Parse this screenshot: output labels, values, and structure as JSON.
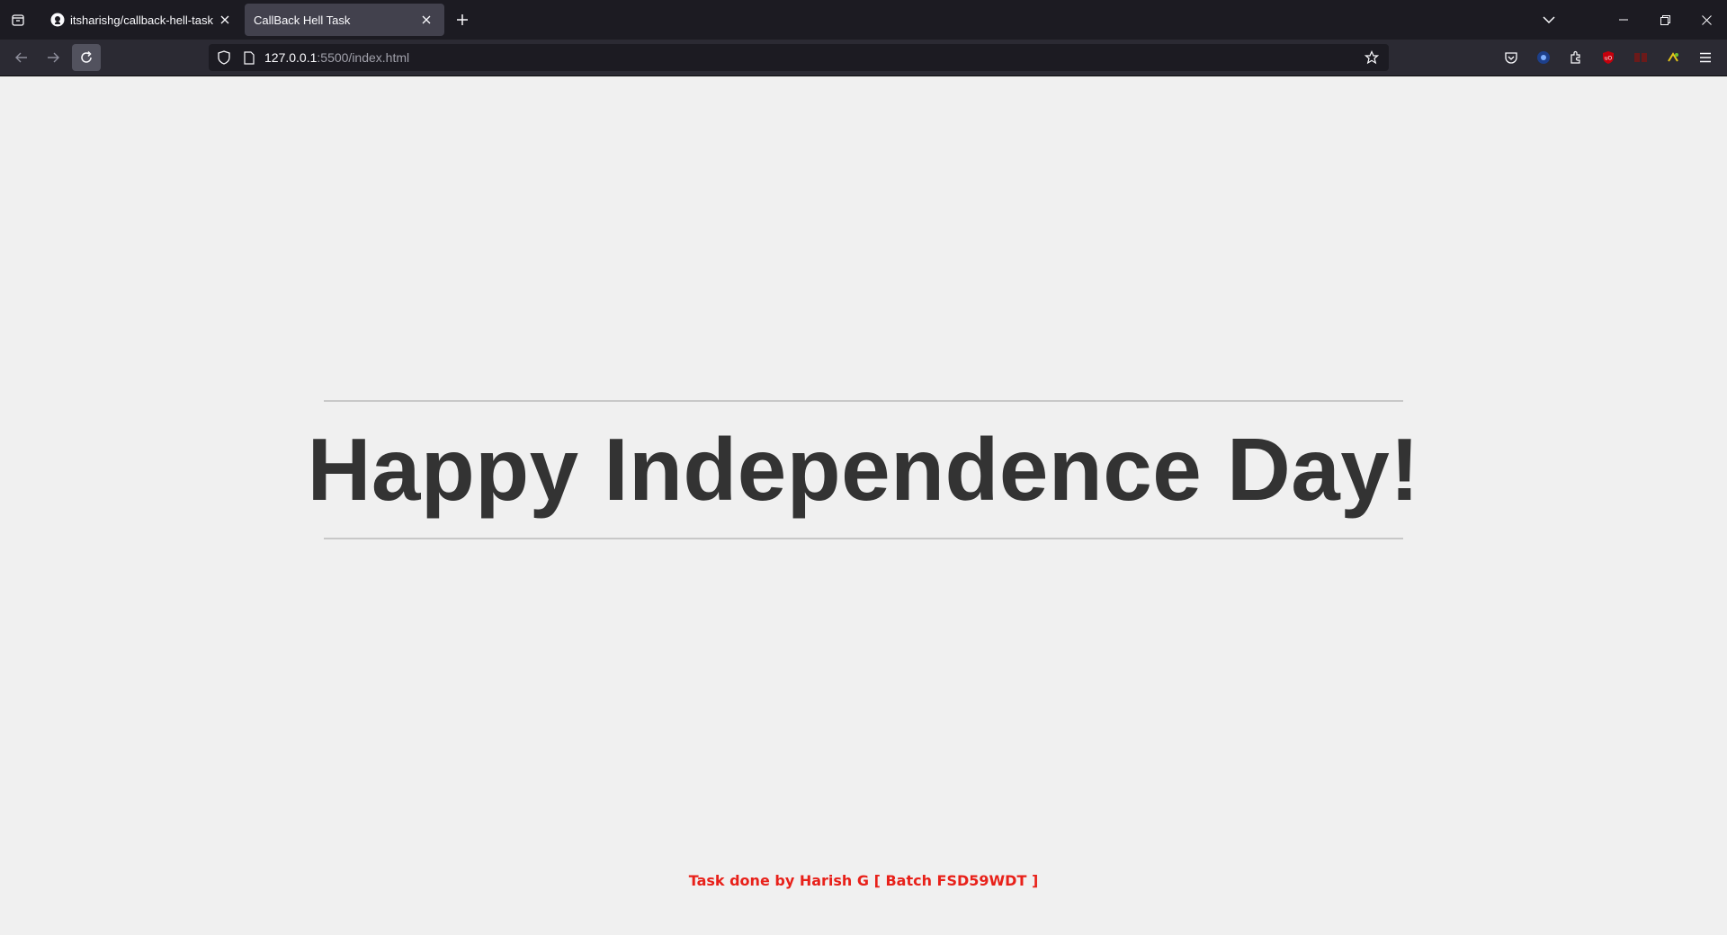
{
  "browser": {
    "tabs": [
      {
        "title": "itsharishg/callback-hell-task",
        "active": false,
        "favicon": "github-icon"
      },
      {
        "title": "CallBack Hell Task",
        "active": true,
        "favicon": ""
      }
    ],
    "url": {
      "host": "127.0.0.1",
      "rest": ":5500/index.html"
    },
    "colors": {
      "tabstrip_bg": "#1c1b22",
      "navbar_bg": "#2b2a33",
      "active_tab_bg": "#42414d"
    }
  },
  "page": {
    "headline": "Happy Independence Day!",
    "credit": "Task done by Harish G [ Batch FSD59WDT ]",
    "colors": {
      "background": "#f0f0f0",
      "headline": "#333333",
      "credit": "#e8211a",
      "rule": "#c8c8c8"
    }
  }
}
